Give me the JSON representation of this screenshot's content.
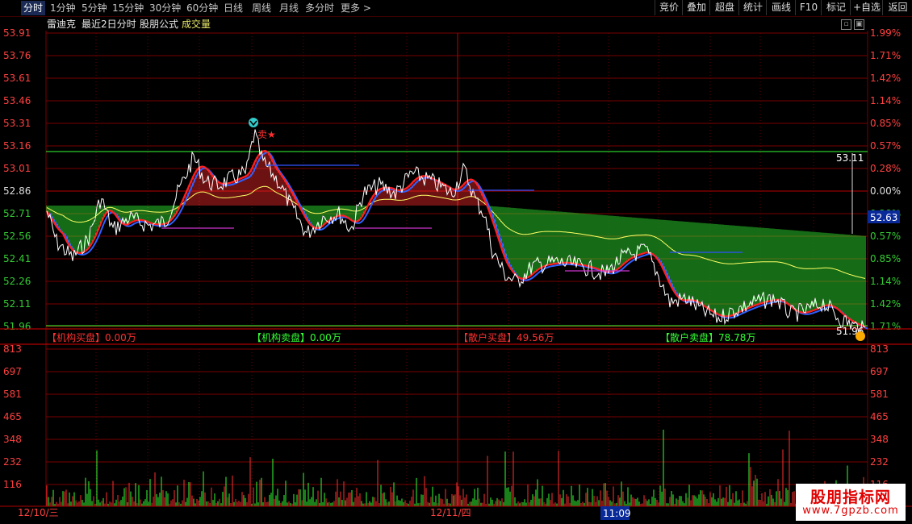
{
  "toolbar": {
    "tabs": [
      "分时",
      "1分钟",
      "5分钟",
      "15分钟",
      "30分钟",
      "60分钟",
      "日线",
      "周线",
      "月线",
      "多分时",
      "更多"
    ],
    "right_buttons": [
      "竞价",
      "叠加",
      "超盘",
      "统计",
      "画线",
      "F10",
      "标记",
      "+自选",
      "返回"
    ]
  },
  "title": {
    "stock_name": "雷迪克",
    "mode": "最近2日分时",
    "formula": "股朋公式",
    "indicator": "成交量"
  },
  "price_axis": {
    "left_labels": [
      "53.91",
      "53.76",
      "53.61",
      "53.46",
      "53.31",
      "53.16",
      "53.01",
      "52.86",
      "52.71",
      "52.56",
      "52.41",
      "52.26",
      "52.11",
      "51.96"
    ],
    "right_labels": [
      "1.99%",
      "1.71%",
      "1.42%",
      "1.14%",
      "0.85%",
      "0.57%",
      "0.28%",
      "0.00%",
      "0.28%",
      "0.57%",
      "0.85%",
      "1.14%",
      "1.42%",
      "1.71%"
    ]
  },
  "volume_axis": {
    "labels": [
      "813",
      "697",
      "581",
      "465",
      "348",
      "232",
      "116"
    ]
  },
  "markers": {
    "sell_label": "卖★",
    "level_line_value": "53.11",
    "current_price": "52.63",
    "low_label": "51.96"
  },
  "summary": {
    "inst_buy": "【机构买盘】0.00万",
    "inst_sell": "【机构卖盘】0.00万",
    "retail_buy": "【散户买盘】49.56万",
    "retail_sell": "【散户卖盘】78.78万"
  },
  "time_axis": {
    "day1": "12/10/三",
    "day2": "12/11/四",
    "cursor_time": "11:09"
  },
  "watermark": {
    "line1": "股朋指标网",
    "line2": "www.7gpzb.com"
  },
  "colors": {
    "grid": "#7a0000",
    "price_line": "#ffffff",
    "avg_line": "#ffff66",
    "ma_red": "#ff2020",
    "ma_blue": "#3060ff",
    "green": "#33ff33",
    "red": "#ff3030"
  }
}
